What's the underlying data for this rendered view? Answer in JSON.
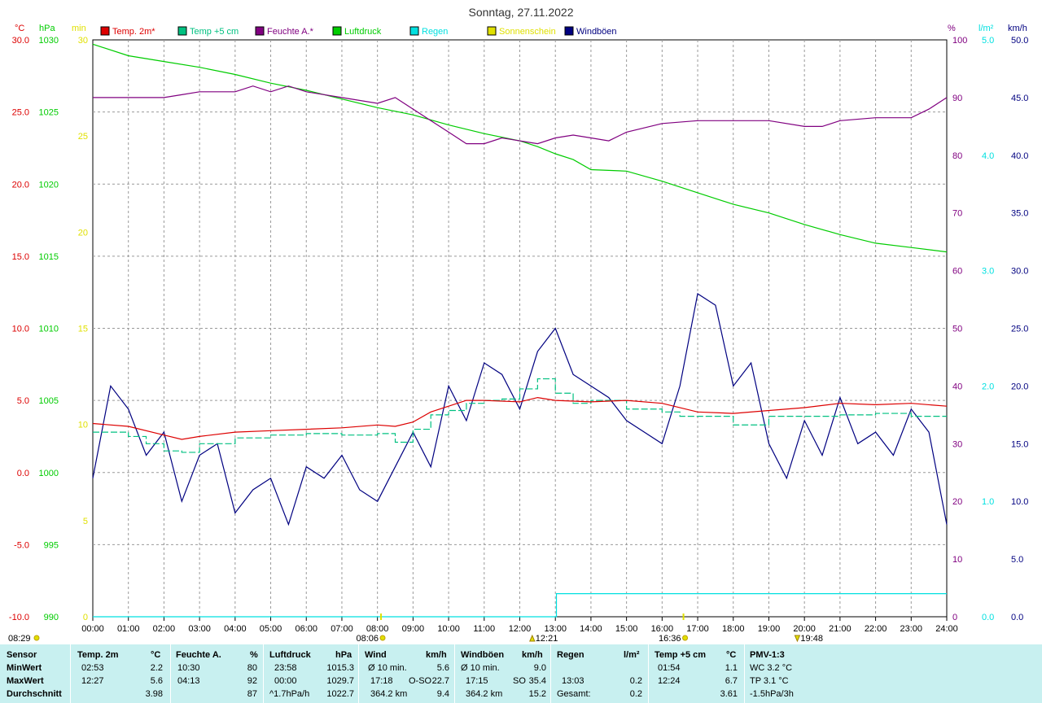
{
  "title": "Sonntag, 27.11.2022",
  "axis_units": {
    "temp": "°C",
    "pressure": "hPa",
    "sun": "min",
    "humidity": "%",
    "rain": "l/m²",
    "wind": "km/h"
  },
  "legend": [
    {
      "label": "Temp. 2m*",
      "color": "#dd0000"
    },
    {
      "label": "Temp +5 cm",
      "color": "#00c080"
    },
    {
      "label": "Feuchte A.*",
      "color": "#800080"
    },
    {
      "label": "Luftdruck",
      "color": "#00cc00"
    },
    {
      "label": "Regen",
      "color": "#00e0e0"
    },
    {
      "label": "Sonnenschein",
      "color": "#e0e000"
    },
    {
      "label": "Windböen",
      "color": "#000080"
    }
  ],
  "colors": {
    "temp": "#dd0000",
    "temp5": "#00c080",
    "humidity": "#800080",
    "pressure": "#00cc00",
    "rain": "#00e0e0",
    "sun": "#e0e000",
    "wind": "#000080",
    "stats_bg": "#c8f0f0"
  },
  "sun_events": {
    "sunrise": "08:06",
    "sunset": "16:36",
    "max_temp_time": "12:21",
    "max_pressure_time": "19:48",
    "left_time": "08:29"
  },
  "stats": {
    "headers": {
      "sensor": "Sensor",
      "temp": "Temp. 2m",
      "temp_u": "°C",
      "hum": "Feuchte A.",
      "hum_u": "%",
      "press": "Luftdruck",
      "press_u": "hPa",
      "wind": "Wind",
      "wind_u": "km/h",
      "gust": "Windböen",
      "gust_u": "km/h",
      "rain": "Regen",
      "rain_u": "l/m²",
      "temp5": "Temp +5 cm",
      "temp5_u": "°C",
      "pmv": "PMV-1:3"
    },
    "row_labels": {
      "min": "MinWert",
      "max": "MaxWert",
      "avg": "Durchschnitt"
    },
    "min": {
      "temp_time": "02:53",
      "temp": "2.2",
      "hum_time": "10:30",
      "hum": "80",
      "press_time": "23:58",
      "press": "1015.3",
      "wind_label": "Ø 10 min.",
      "wind": "5.6",
      "gust_label": "Ø 10 min.",
      "gust": "9.0",
      "temp5_time": "01:54",
      "temp5": "1.1",
      "pmv": "WC 3.2 °C"
    },
    "max": {
      "temp_time": "12:27",
      "temp": "5.6",
      "hum_time": "04:13",
      "hum": "92",
      "press_time": "00:00",
      "press": "1029.7",
      "wind_time": "17:18",
      "wind_dir": "O-SO",
      "wind": "22.7",
      "gust_time": "17:15",
      "gust_dir": "SO",
      "gust": "35.4",
      "rain_time": "13:03",
      "rain": "0.2",
      "temp5_time": "12:24",
      "temp5": "6.7",
      "pmv": "TP 3.1 °C"
    },
    "avg": {
      "temp": "3.98",
      "hum": "87",
      "press_trend": "^1.7hPa/h",
      "press": "1022.7",
      "wind_dist": "364.2 km",
      "wind": "9.4",
      "gust_dist": "364.2 km",
      "gust": "15.2",
      "rain_label": "Gesamt:",
      "rain": "0.2",
      "temp5": "3.61",
      "pmv": "-1.5hPa/3h"
    }
  },
  "chart_data": {
    "type": "line",
    "title": "Sonntag, 27.11.2022",
    "x_unit": "hour of day",
    "xlim": [
      0,
      24
    ],
    "x_ticks": [
      "00:00",
      "01:00",
      "02:00",
      "03:00",
      "04:00",
      "05:00",
      "06:00",
      "07:00",
      "08:00",
      "09:00",
      "10:00",
      "11:00",
      "12:00",
      "13:00",
      "14:00",
      "15:00",
      "16:00",
      "17:00",
      "18:00",
      "19:00",
      "20:00",
      "21:00",
      "22:00",
      "23:00",
      "24:00"
    ],
    "axes": {
      "temp": {
        "unit": "°C",
        "range": [
          -10,
          30
        ],
        "ticks": [
          "30.0",
          "25.0",
          "20.0",
          "15.0",
          "10.0",
          "5.0",
          "0.0",
          "-5.0",
          "-10.0"
        ]
      },
      "pressure": {
        "unit": "hPa",
        "range": [
          990,
          1030
        ],
        "ticks": [
          "1030",
          "1025",
          "1020",
          "1015",
          "1010",
          "1005",
          "1000",
          "995",
          "990"
        ]
      },
      "sun": {
        "unit": "min",
        "range": [
          0,
          30
        ],
        "ticks": [
          "30",
          "25",
          "20",
          "15",
          "10",
          "5",
          "0"
        ]
      },
      "humidity": {
        "unit": "%",
        "range": [
          0,
          100
        ],
        "ticks": [
          "100",
          "90",
          "80",
          "70",
          "60",
          "50",
          "40",
          "30",
          "20",
          "10",
          "0"
        ]
      },
      "rain": {
        "unit": "l/m²",
        "range": [
          0,
          5
        ],
        "ticks": [
          "5.0",
          "4.0",
          "3.0",
          "2.0",
          "1.0",
          "0.0"
        ]
      },
      "wind": {
        "unit": "km/h",
        "range": [
          0,
          50
        ],
        "ticks": [
          "50.0",
          "45.0",
          "40.0",
          "35.0",
          "30.0",
          "25.0",
          "20.0",
          "15.0",
          "10.0",
          "5.0",
          "0.0"
        ]
      }
    },
    "series": [
      {
        "name": "Temp. 2m*",
        "axis": "temp",
        "x": [
          0,
          1,
          2,
          2.5,
          3,
          4,
          5,
          6,
          7,
          8,
          8.5,
          9,
          9.5,
          10,
          10.5,
          11,
          12,
          12.5,
          13,
          14,
          15,
          16,
          17,
          18,
          19,
          20,
          21,
          22,
          23,
          24
        ],
        "y": [
          3.4,
          3.2,
          2.6,
          2.3,
          2.5,
          2.8,
          2.9,
          3.0,
          3.1,
          3.3,
          3.2,
          3.5,
          4.2,
          4.6,
          5.0,
          5.0,
          4.9,
          5.2,
          5.0,
          4.9,
          5.0,
          4.8,
          4.2,
          4.1,
          4.3,
          4.5,
          4.8,
          4.7,
          4.8,
          4.6
        ]
      },
      {
        "name": "Temp +5 cm",
        "axis": "temp",
        "x": [
          0,
          1,
          1.5,
          2,
          2.5,
          3,
          4,
          5,
          6,
          7,
          8,
          8.5,
          9,
          9.5,
          10,
          10.5,
          11,
          11.5,
          12,
          12.5,
          13,
          13.5,
          14,
          15,
          16,
          16.5,
          17,
          18,
          19,
          20,
          21,
          22,
          23,
          24
        ],
        "y": [
          2.8,
          2.5,
          2.0,
          1.5,
          1.4,
          2.0,
          2.4,
          2.6,
          2.7,
          2.6,
          2.7,
          2.1,
          3.0,
          4.0,
          4.3,
          4.8,
          5.0,
          5.1,
          5.8,
          6.5,
          5.5,
          4.8,
          5.0,
          4.4,
          4.2,
          3.9,
          3.9,
          3.3,
          3.9,
          3.9,
          4.0,
          4.1,
          3.9,
          3.9
        ]
      },
      {
        "name": "Feuchte A.*",
        "axis": "humidity",
        "x": [
          0,
          1,
          2,
          2.5,
          3,
          4,
          4.5,
          5,
          5.5,
          6,
          7,
          8,
          8.5,
          9,
          9.5,
          10,
          10.5,
          11,
          11.5,
          12,
          12.5,
          13,
          13.5,
          14,
          14.5,
          15,
          16,
          17,
          18,
          19,
          20,
          20.5,
          21,
          22,
          23,
          23.5,
          24
        ],
        "y": [
          90,
          90,
          90,
          90.5,
          91,
          91,
          92,
          91,
          92,
          91,
          90,
          89,
          90,
          88,
          86,
          84,
          82,
          82,
          83,
          82.5,
          82,
          83,
          83.5,
          83,
          82.5,
          84,
          85.5,
          86,
          86,
          86,
          85,
          85,
          86,
          86.5,
          86.5,
          88,
          90
        ]
      },
      {
        "name": "Luftdruck",
        "axis": "pressure",
        "x": [
          0,
          1,
          2,
          3,
          4,
          5,
          6,
          7,
          8,
          9,
          10,
          11,
          12,
          12.5,
          13,
          13.5,
          14,
          15,
          16,
          17,
          18,
          19,
          20,
          21,
          22,
          23,
          24
        ],
        "y": [
          1029.7,
          1028.9,
          1028.5,
          1028.1,
          1027.6,
          1027.0,
          1026.5,
          1025.9,
          1025.3,
          1024.8,
          1024.1,
          1023.5,
          1023.0,
          1022.6,
          1022.1,
          1021.7,
          1021.0,
          1020.9,
          1020.2,
          1019.4,
          1018.6,
          1018.0,
          1017.2,
          1016.5,
          1015.9,
          1015.6,
          1015.3
        ]
      },
      {
        "name": "Regen",
        "axis": "rain",
        "x": [
          0,
          13.0,
          13.03,
          24
        ],
        "y": [
          0,
          0,
          0.2,
          0.2
        ]
      },
      {
        "name": "Windböen",
        "axis": "wind",
        "x": [
          0,
          0.5,
          1,
          1.5,
          2,
          2.5,
          3,
          3.5,
          4,
          4.5,
          5,
          5.5,
          6,
          6.5,
          7,
          7.5,
          8,
          8.5,
          9,
          9.5,
          10,
          10.5,
          11,
          11.5,
          12,
          12.5,
          13,
          13.5,
          14,
          14.5,
          15,
          15.5,
          16,
          16.5,
          17,
          17.5,
          18,
          18.5,
          19,
          19.5,
          20,
          20.5,
          21,
          21.5,
          22,
          22.5,
          23,
          23.5,
          24
        ],
        "y": [
          12,
          20,
          18,
          14,
          16,
          10,
          14,
          15,
          9,
          11,
          12,
          8,
          13,
          12,
          14,
          11,
          10,
          13,
          16,
          13,
          20,
          17,
          22,
          21,
          18,
          23,
          25,
          21,
          20,
          19,
          17,
          16,
          15,
          20,
          28,
          27,
          20,
          22,
          15,
          12,
          17,
          14,
          19,
          15,
          16,
          14,
          18,
          16,
          8
        ]
      }
    ],
    "sunshine": {
      "name": "Sonnenschein",
      "total_min": 0
    },
    "rain_total": 0.2
  }
}
